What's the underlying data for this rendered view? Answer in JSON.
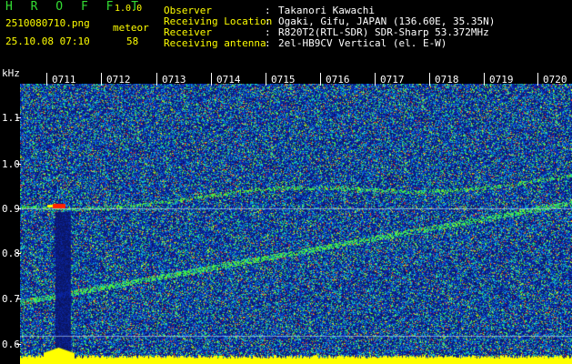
{
  "app": {
    "name": "H R O F F T",
    "version": "1.0.0"
  },
  "file": {
    "name": "2510080710.png",
    "datetime": "25.10.08 07:10"
  },
  "meteor": {
    "label": "meteor",
    "count": "58"
  },
  "info": [
    {
      "label": "Observer",
      "value": "Takanori Kawachi"
    },
    {
      "label": "Receiving Location",
      "value": "Ogaki, Gifu, JAPAN (136.60E, 35.35N)"
    },
    {
      "label": "Receiver",
      "value": "R820T2(RTL-SDR) SDR-Sharp 53.372MHz"
    },
    {
      "label": "Receiving antenna",
      "value": "2el-HB9CV Vertical (el. E-W)"
    }
  ],
  "y_axis": {
    "unit": "kHz",
    "ticks": [
      "1.1",
      "1.0",
      "0.9",
      "0.8",
      "0.7",
      "0.6"
    ]
  },
  "x_axis": {
    "ticks": [
      "0711",
      "0712",
      "0713",
      "0714",
      "0715",
      "0716",
      "0717",
      "0718",
      "0719",
      "0720"
    ]
  },
  "colors": {
    "background": "#000000",
    "spectrum_low": "#0b1c6e",
    "spectrum_high": "#ff2200",
    "signal_baseline": "#ffff00",
    "header_text": "#ffff00",
    "value_text": "#ffffff"
  }
}
